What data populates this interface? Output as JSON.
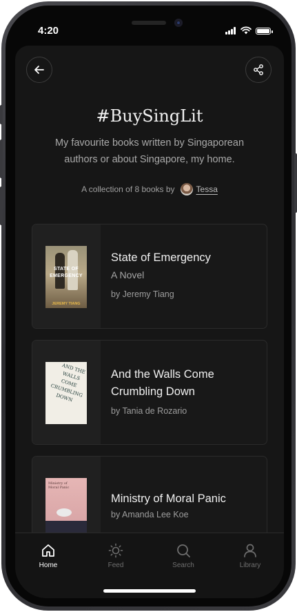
{
  "status": {
    "time": "4:20"
  },
  "header": {
    "back_icon": "back-arrow-icon",
    "share_icon": "share-icon"
  },
  "collection": {
    "title": "#BuySingLit",
    "description": "My favourite books written by Singaporean authors or about Singapore, my home.",
    "byline_prefix": "A collection of 8 books by",
    "author": "Tessa"
  },
  "books": [
    {
      "title": "State of Emergency",
      "subtitle": "A Novel",
      "author": "by Jeremy Tiang",
      "cover_text": [
        "STATE OF",
        "EMERGENCY"
      ],
      "cover_author": "JEREMY TIANG"
    },
    {
      "title": "And the Walls Come Crumbling Down",
      "author": "by Tania de Rozario",
      "cover_text": [
        "AND THE",
        "WALLS",
        "COME",
        "CRUMBLING",
        "DOWN"
      ]
    },
    {
      "title": "Ministry of Moral Panic",
      "author": "by Amanda Lee Koe",
      "cover_text": [
        "Ministry of",
        "Moral Panic"
      ]
    }
  ],
  "tabs": [
    {
      "label": "Home",
      "icon": "home-icon",
      "active": true
    },
    {
      "label": "Feed",
      "icon": "sun-icon",
      "active": false
    },
    {
      "label": "Search",
      "icon": "search-icon",
      "active": false
    },
    {
      "label": "Library",
      "icon": "user-icon",
      "active": false
    }
  ],
  "colors": {
    "screen_bg": "#161616",
    "card_border": "#2b2b2b",
    "text_primary": "#f0f0f0",
    "text_muted": "#a7a7a7"
  }
}
